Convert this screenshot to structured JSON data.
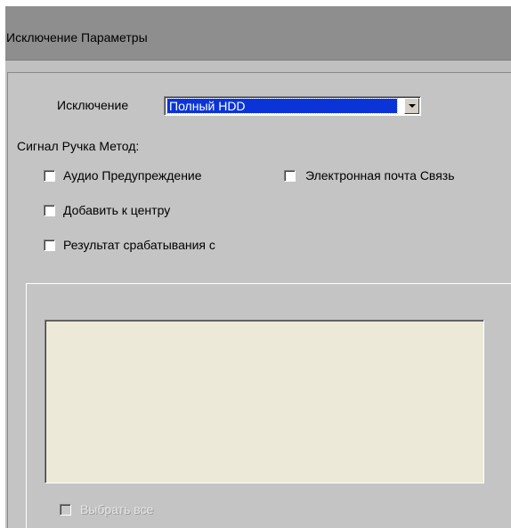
{
  "window": {
    "title": "Исключение Параметры"
  },
  "exception": {
    "label": "Исключение",
    "selected": "Полный HDD"
  },
  "method": {
    "label": "Сигнал Ручка Метод:",
    "options": {
      "audio": {
        "label": "Аудио Предупреждение",
        "checked": false
      },
      "email": {
        "label": "Электронная почта Связь",
        "checked": false
      },
      "center": {
        "label": "Добавить к центру",
        "checked": false
      },
      "trigger": {
        "label": "Результат срабатывания с",
        "checked": false
      }
    }
  },
  "trigger_outputs": {
    "items": [],
    "select_all": {
      "label": "Выбрать все",
      "checked": false,
      "enabled": false
    }
  },
  "colors": {
    "window_bg": "#c0c0c0",
    "titlebar_bg": "#8e8e8e",
    "selection_bg": "#0a34d8",
    "listbox_bg": "#ece9d8"
  },
  "icons": {
    "dropdown": "chevron-down-icon"
  }
}
